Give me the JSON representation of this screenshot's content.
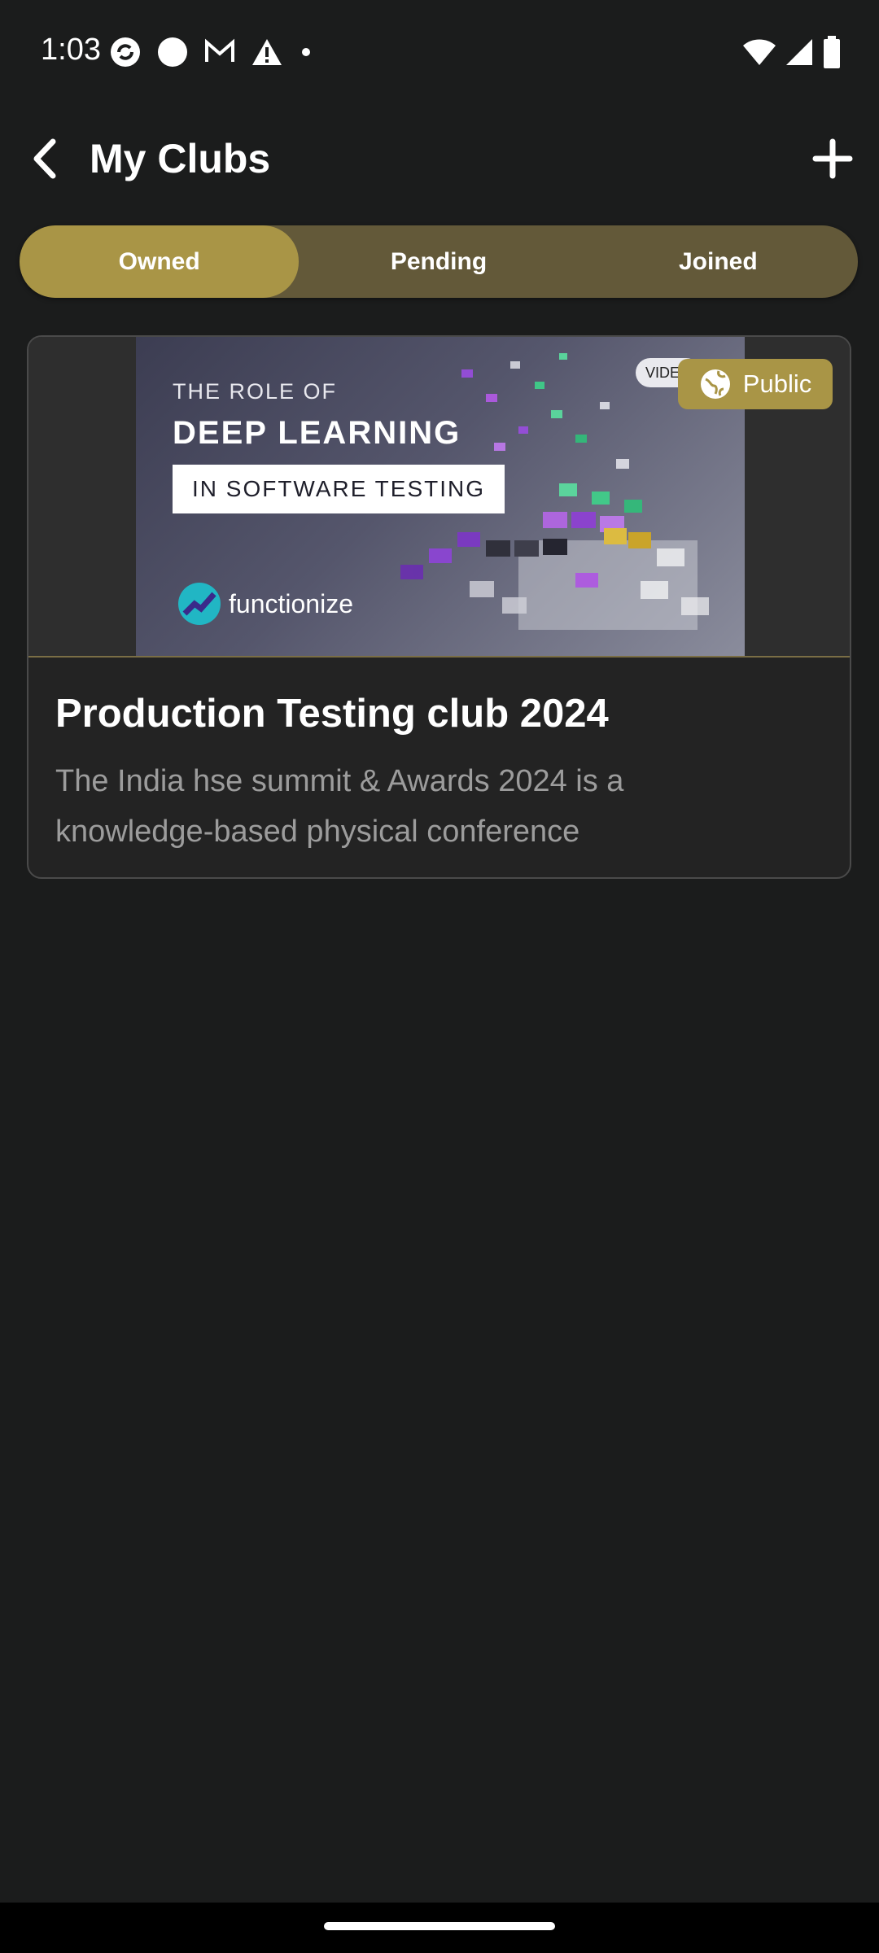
{
  "status_bar": {
    "time": "1:03",
    "left_icons": [
      "sync-icon",
      "circle-icon",
      "gmail-icon",
      "warning-icon",
      "dot-icon"
    ],
    "right_icons": [
      "wifi-icon",
      "signal-icon",
      "battery-icon"
    ]
  },
  "appbar": {
    "title": "My Clubs"
  },
  "tabs": [
    {
      "label": "Owned",
      "active": true
    },
    {
      "label": "Pending",
      "active": false
    },
    {
      "label": "Joined",
      "active": false
    }
  ],
  "club_card": {
    "banner": {
      "line1": "THE ROLE OF",
      "line2": "DEEP LEARNING",
      "line3": "IN SOFTWARE TESTING",
      "logo_text": "functionize",
      "chip_text": "VIDEO"
    },
    "visibility": "Public",
    "title": "Production Testing club 2024",
    "description": "The India hse summit & Awards 2024 is a knowledge-based physical conference"
  },
  "colors": {
    "background": "#1b1c1c",
    "accent": "#a99546",
    "tab_track": "#635939",
    "card": "#232323"
  }
}
